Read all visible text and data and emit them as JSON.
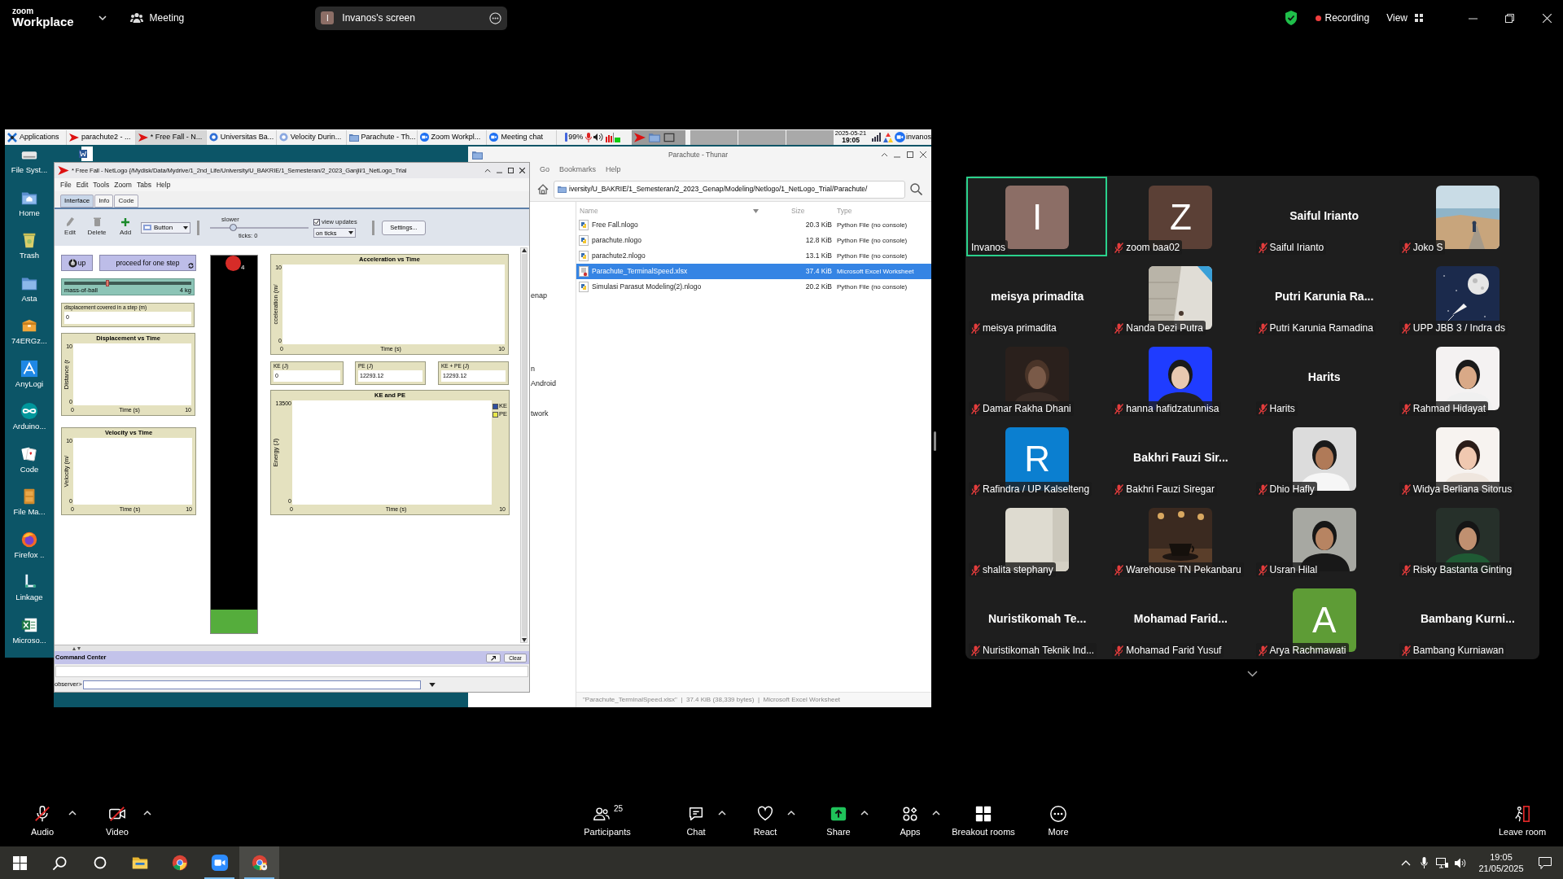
{
  "top_bar": {
    "logo": "zoom",
    "product": "Workplace",
    "meeting": "Meeting",
    "screen_share": {
      "initial": "I",
      "label": "Invanos's screen"
    },
    "recording": "Recording",
    "view": "View"
  },
  "shared_screen": {
    "panel": {
      "tasks": [
        {
          "label": "Applications",
          "kind": "menu",
          "selected": false
        },
        {
          "label": "parachute2 - ...",
          "kind": "netlogo",
          "selected": false
        },
        {
          "label": "* Free Fall - N...",
          "kind": "netlogo",
          "selected": true
        },
        {
          "label": "Universitas Ba...",
          "kind": "browser",
          "selected": false
        },
        {
          "label": "Velocity Durin...",
          "kind": "browser_dim",
          "selected": false
        },
        {
          "label": "Parachute - Th...",
          "kind": "folder",
          "selected": false
        },
        {
          "label": "Zoom Workpl...",
          "kind": "zoom",
          "selected": false
        },
        {
          "label": "Meeting chat",
          "kind": "zoom",
          "selected": false
        }
      ],
      "battery": "99%",
      "date": "2025-05-21",
      "time": "19:05",
      "user": "invanos"
    },
    "desktop_icons": [
      {
        "label": "File Syst...",
        "kind": "drive"
      },
      {
        "label": "Home",
        "kind": "home"
      },
      {
        "label": "Trash",
        "kind": "trash"
      },
      {
        "label": "Asta",
        "kind": "folder"
      },
      {
        "label": "74ERGz...",
        "kind": "package"
      },
      {
        "label": "AnyLogi",
        "kind": "triangle"
      },
      {
        "label": "Arduino...",
        "kind": "infinity"
      },
      {
        "label": "Code",
        "kind": "cards"
      },
      {
        "label": "File Ma...",
        "kind": "cabinet"
      },
      {
        "label": "Firefox ..",
        "kind": "browser"
      },
      {
        "label": "Linkage",
        "kind": "linkage"
      },
      {
        "label": "Microso...",
        "kind": "spreadsheet"
      }
    ],
    "thunar": {
      "title": "Parachute - Thunar",
      "menus": [
        "Go",
        "Bookmarks",
        "Help"
      ],
      "path": "iversity/U_BAKRIE/1_Semesteran/2_2023_Genap/Modeling/Netlogo/1_NetLogo_Trial/Parachute/",
      "sidebar": [
        "enap",
        "n",
        "Android",
        "twork"
      ],
      "columns": [
        "Name",
        "Size",
        "Type"
      ],
      "files": [
        {
          "name": "Free Fall.nlogo",
          "size": "20.3 KiB",
          "type": "Python File (no console)",
          "kind": "python",
          "selected": false
        },
        {
          "name": "parachute.nlogo",
          "size": "12.8 KiB",
          "type": "Python File (no console)",
          "kind": "python",
          "selected": false
        },
        {
          "name": "parachute2.nlogo",
          "size": "13.1 KiB",
          "type": "Python File (no console)",
          "kind": "python",
          "selected": false
        },
        {
          "name": "Parachute_TerminalSpeed.xlsx",
          "size": "37.4 KiB",
          "type": "Microsoft Excel Worksheet",
          "kind": "excel",
          "selected": true
        },
        {
          "name": "Simulasi Parasut Modeling(2).nlogo",
          "size": "20.2 KiB",
          "type": "Python File (no console)",
          "kind": "python",
          "selected": false
        }
      ],
      "status": "\"Parachute_TerminalSpeed.xlsx\"  |  37.4 KiB (38,339 bytes)  |  Microsoft Excel Worksheet"
    },
    "netlogo": {
      "title": "* Free Fall - NetLogo {/Mydisk/Data/Mydrive/1_2nd_Life/University/U_BAKRIE/1_Semesteran/2_2023_Ganjil/1_NetLogo_Trial",
      "menus": [
        "File",
        "Edit",
        "Tools",
        "Zoom",
        "Tabs",
        "Help"
      ],
      "tabs": [
        {
          "label": "Interface",
          "selected": true
        },
        {
          "label": "Info",
          "selected": false
        },
        {
          "label": "Code",
          "selected": false
        }
      ],
      "tools": [
        {
          "label": "Edit",
          "kind": "edit"
        },
        {
          "label": "Delete",
          "kind": "delete"
        },
        {
          "label": "Add",
          "kind": "add"
        }
      ],
      "widget_type": "Button",
      "speed": {
        "label": "slower",
        "level": 0.23
      },
      "ticks": "ticks: 0",
      "view_updates": {
        "label": "view updates",
        "checked": true
      },
      "update_mode": "on ticks",
      "settings": "Settings...",
      "buttons": [
        {
          "label": "up",
          "forever": false
        },
        {
          "label": "proceed for one step",
          "forever": true
        }
      ],
      "slider": {
        "label": "mass-of-ball",
        "value": "4 kg",
        "level": 0.34
      },
      "monitors": [
        {
          "label": "displacement covered in a step (m)",
          "value": "0"
        },
        {
          "label": "KE (J)",
          "value": "0"
        },
        {
          "label": "PE (J)",
          "value": "12293.12"
        },
        {
          "label": "KE + PE (J)",
          "value": "12293.12"
        }
      ],
      "plots": [
        {
          "title": "Displacement vs Time",
          "ylabel": "Distance (r",
          "ymax": "10",
          "ymin": "0",
          "xlabel": "Time (s)",
          "xmin": "0",
          "xmax": "10"
        },
        {
          "title": "Velocity vs Time",
          "ylabel": "Velocity (m/",
          "ymax": "10",
          "ymin": "0",
          "xlabel": "Time (s)",
          "xmin": "0",
          "xmax": "10"
        },
        {
          "title": "Acceleration vs Time",
          "ylabel": "cceleration (m/",
          "ymax": "10",
          "ymin": "0",
          "xlabel": "Time (s)",
          "xmin": "0",
          "xmax": "10"
        },
        {
          "title": "KE and PE",
          "ylabel": "Energy (J)",
          "ymax": "13500",
          "ymin": "0",
          "xlabel": "Time (s)",
          "xmin": "0",
          "xmax": "10",
          "legend": [
            {
              "label": "KE",
              "color": "#2f4f9f"
            },
            {
              "label": "PE",
              "color": "#e8e84a"
            }
          ]
        }
      ],
      "view": {
        "turtle_label": "4"
      },
      "command_center": {
        "title": "Command Center",
        "clear": "Clear",
        "prompt": "observer>"
      }
    }
  },
  "gallery": {
    "participants": [
      {
        "name": "Invanos",
        "muted": false,
        "speaking": true,
        "tile": {
          "kind": "initial",
          "letter": "I",
          "color": "#8c6e66"
        }
      },
      {
        "name": "zoom baa02",
        "muted": true,
        "speaking": false,
        "tile": {
          "kind": "initial",
          "letter": "Z",
          "color": "#5b4036"
        }
      },
      {
        "name": "Saiful Irianto",
        "muted": true,
        "speaking": false,
        "tile": {
          "kind": "name",
          "text": "Saiful Irianto"
        }
      },
      {
        "name": "Joko S",
        "muted": true,
        "speaking": false
      },
      {
        "name": "meisya primadita",
        "muted": true,
        "speaking": false,
        "tile": {
          "kind": "name",
          "text": "meisya primadita"
        }
      },
      {
        "name": "Nanda Dezi Putra",
        "muted": true,
        "speaking": false
      },
      {
        "name": "Putri Karunia Ramadina",
        "muted": true,
        "speaking": false,
        "tile": {
          "kind": "name",
          "text": "Putri Karunia Ra..."
        }
      },
      {
        "name": "UPP JBB 3 / Indra ds",
        "muted": true,
        "speaking": false
      },
      {
        "name": "Damar Rakha Dhani",
        "muted": true,
        "speaking": false
      },
      {
        "name": "hanna hafidzatunnisa",
        "muted": true,
        "speaking": false
      },
      {
        "name": "Harits",
        "muted": true,
        "speaking": false,
        "tile": {
          "kind": "name",
          "text": "Harits"
        }
      },
      {
        "name": "Rahmad Hidayat",
        "muted": true,
        "speaking": false
      },
      {
        "name": "Rafindra / UP Kalselteng",
        "muted": true,
        "speaking": false,
        "tile": {
          "kind": "initial",
          "letter": "R",
          "color": "#0b7fd0"
        }
      },
      {
        "name": "Bakhri Fauzi Siregar",
        "muted": true,
        "speaking": false,
        "tile": {
          "kind": "name",
          "text": "Bakhri Fauzi Sir..."
        }
      },
      {
        "name": "Dhio Hafly",
        "muted": true,
        "speaking": false
      },
      {
        "name": "Widya Berliana Sitorus",
        "muted": true,
        "speaking": false
      },
      {
        "name": "shalita stephany",
        "muted": true,
        "speaking": false
      },
      {
        "name": "Warehouse TN Pekanbaru",
        "muted": true,
        "speaking": false
      },
      {
        "name": "Usran Hilal",
        "muted": true,
        "speaking": false
      },
      {
        "name": "Risky Bastanta Ginting",
        "muted": true,
        "speaking": false
      },
      {
        "name": "Nuristikomah Teknik Ind...",
        "muted": true,
        "speaking": false,
        "tile": {
          "kind": "name",
          "text": "Nuristikomah Te..."
        }
      },
      {
        "name": "Mohamad Farid Yusuf",
        "muted": true,
        "speaking": false,
        "tile": {
          "kind": "name",
          "text": "Mohamad Farid..."
        }
      },
      {
        "name": "Arya Rachmawati",
        "muted": true,
        "speaking": false,
        "tile": {
          "kind": "initial",
          "letter": "A",
          "color": "#5e9c36"
        }
      },
      {
        "name": "Bambang Kurniawan",
        "muted": true,
        "speaking": false,
        "tile": {
          "kind": "name",
          "text": "Bambang Kurni..."
        }
      }
    ]
  },
  "meeting_controls": {
    "left": [
      {
        "label": "Audio",
        "kind": "audio",
        "off": true,
        "caret": true
      },
      {
        "label": "Video",
        "kind": "video",
        "off": true,
        "caret": true
      }
    ],
    "center": [
      {
        "label": "Participants",
        "kind": "participants",
        "count": "25",
        "caret": false
      },
      {
        "label": "Chat",
        "kind": "chat",
        "caret": true
      },
      {
        "label": "React",
        "kind": "react",
        "caret": true
      },
      {
        "label": "Share",
        "kind": "share",
        "caret": true
      },
      {
        "label": "Apps",
        "kind": "apps",
        "caret": true
      },
      {
        "label": "Breakout rooms",
        "kind": "breakout",
        "caret": false
      },
      {
        "label": "More",
        "kind": "more",
        "caret": false
      }
    ],
    "leave": "Leave room"
  },
  "taskbar": {
    "apps": [
      {
        "kind": "start",
        "selected": false,
        "running": false
      },
      {
        "kind": "search",
        "selected": false,
        "running": false
      },
      {
        "kind": "task_view",
        "selected": false,
        "running": false
      },
      {
        "kind": "explorer",
        "selected": false,
        "running": false
      },
      {
        "kind": "chrome",
        "selected": false,
        "running": false
      },
      {
        "kind": "zoom",
        "selected": false,
        "running": true
      },
      {
        "kind": "chrome_profile",
        "selected": true,
        "running": true
      }
    ],
    "time": "19:05",
    "date": "21/05/2025"
  }
}
